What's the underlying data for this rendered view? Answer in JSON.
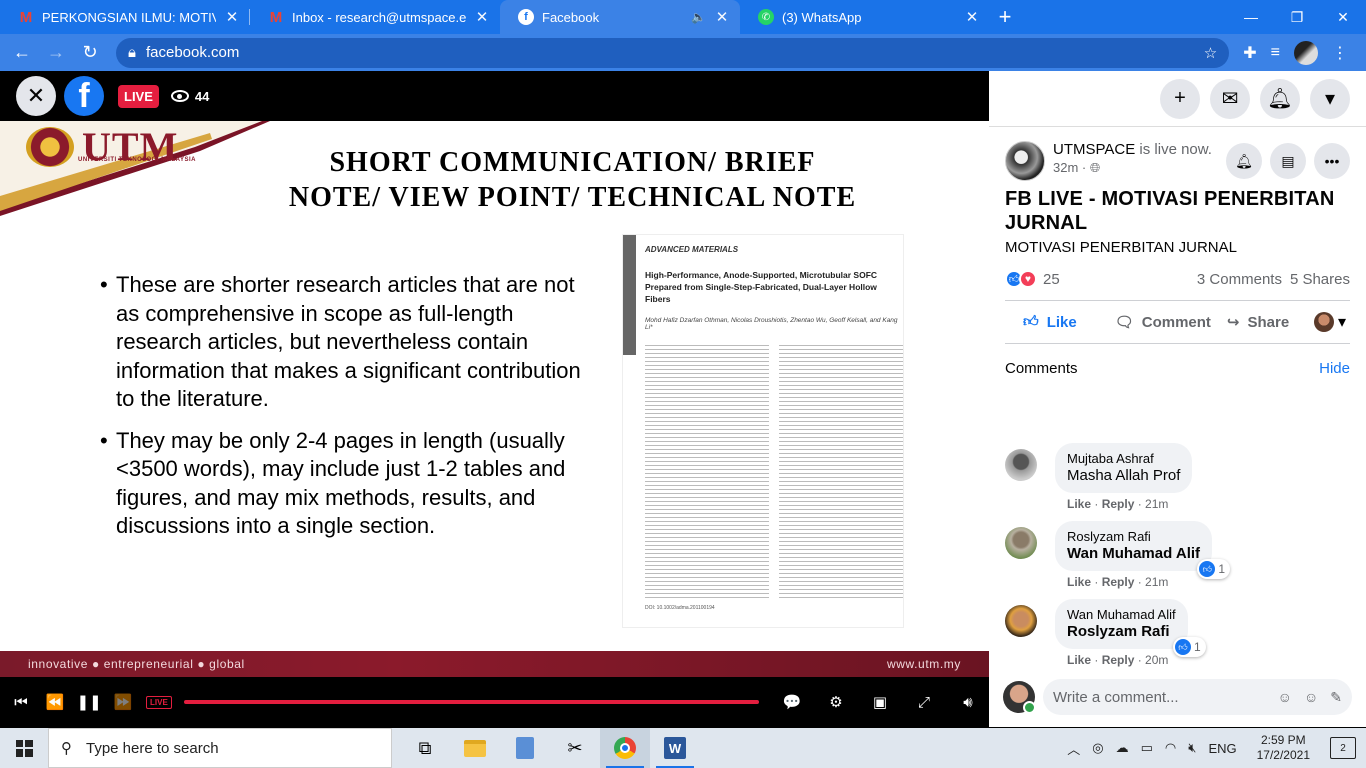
{
  "browser": {
    "tabs": [
      {
        "title": "PERKONGSIAN ILMU: MOTIVASI",
        "icon": "gmail-icon",
        "active": false
      },
      {
        "title": "Inbox - research@utmspace.edu",
        "icon": "gmail-icon",
        "active": false
      },
      {
        "title": "Facebook",
        "icon": "facebook-icon",
        "active": true
      },
      {
        "title": "(3) WhatsApp",
        "icon": "whatsapp-icon",
        "active": false
      }
    ],
    "new_tab": "+",
    "url": "facebook.com"
  },
  "video": {
    "live_label": "LIVE",
    "viewer_count": "44",
    "slide": {
      "logo_text": "UTM",
      "logo_subtext": "UNIVERSITI TEKNOLOGI MALAYSIA",
      "title_line1": "SHORT COMMUNICATION/ BRIEF",
      "title_line2": "NOTE/ VIEW POINT/ TECHNICAL NOTE",
      "bullet1": "These are shorter research articles that are not  as comprehensive in scope as full-length research  articles, but nevertheless contain information that  makes a significant contribution to the literature.",
      "bullet2": "They may be only 2-4 pages in length (usually <3500 words), may include just 1-2 tables and  figures, and may mix methods, results, and  discussions into a single section.",
      "paper_journal": "ADVANCED MATERIALS",
      "paper_title": "High-Performance, Anode-Supported, Microtubular SOFC Prepared from Single-Step-Fabricated, Dual-Layer Hollow Fibers",
      "paper_authors": "Mohd Hafiz Dzarfan Othman, Nicolas Droushiotis, Zhentao Wu, Geoff Kelsall, and Kang Li*",
      "paper_doi": "DOI: 10.1002/adma.201100194",
      "footer_left": "innovative ● entrepreneurial ● global",
      "footer_right": "www.utm.my"
    },
    "controls_live": "LIVE"
  },
  "sidebar": {
    "post": {
      "page_name": "UTMSPACE",
      "status": "is live now.",
      "time": "32m · ",
      "title": "FB LIVE - MOTIVASI PENERBITAN JURNAL",
      "subtitle": "MOTIVASI PENERBITAN JURNAL",
      "reaction_count": "25",
      "comments_count": "3 Comments",
      "shares_count": "5 Shares",
      "like_label": "Like",
      "comment_label": "Comment",
      "share_label": "Share"
    },
    "comments_header": "Comments",
    "hide_label": "Hide",
    "comments": [
      {
        "author": "Mujtaba Ashraf",
        "text": "Masha Allah Prof",
        "like": "Like",
        "reply": "Reply",
        "time": "21m",
        "reactions": ""
      },
      {
        "author": "Roslyzam Rafi",
        "text": "Wan Muhamad Alif",
        "like": "Like",
        "reply": "Reply",
        "time": "21m",
        "reactions": "1"
      },
      {
        "author": "Wan Muhamad Alif",
        "text": "Roslyzam Rafi",
        "like": "Like",
        "reply": "Reply",
        "time": "20m",
        "reactions": "1"
      }
    ],
    "write_placeholder": "Write a comment..."
  },
  "taskbar": {
    "search_placeholder": "Type here to search",
    "language": "ENG",
    "time": "2:59 PM",
    "date": "17/2/2021",
    "notification_count": "2"
  },
  "colors": {
    "chrome_blue": "#1a73e8",
    "facebook_blue": "#1877f2",
    "live_red": "#e41e3f",
    "utm_maroon": "#8b1a2b"
  }
}
